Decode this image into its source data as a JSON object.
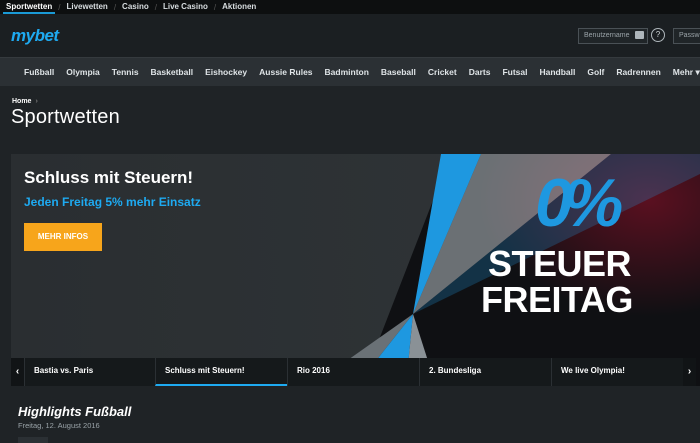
{
  "topbar": {
    "tabs": [
      "Sportwetten",
      "Livewetten",
      "Casino",
      "Live Casino",
      "Aktionen"
    ]
  },
  "header": {
    "logo": "mybet",
    "username_placeholder": "Benutzername",
    "password_placeholder": "Passwort",
    "help_label": "?"
  },
  "nav": {
    "items": [
      "Fußball",
      "Olympia",
      "Tennis",
      "Basketball",
      "Eishockey",
      "Aussie Rules",
      "Badminton",
      "Baseball",
      "Cricket",
      "Darts",
      "Futsal",
      "Handball",
      "Golf",
      "Radrennen",
      "Mehr ▾"
    ]
  },
  "breadcrumb": {
    "home": "Home",
    "separator": "›"
  },
  "page": {
    "title": "Sportwetten"
  },
  "banner": {
    "headline": "Schluss mit Steuern!",
    "subline": "Jeden Freitag 5% mehr Einsatz",
    "button": "MEHR INFOS",
    "percent_graphic": "0%",
    "title_line1": "STEUER",
    "title_line2": "FREITAG"
  },
  "slider": {
    "prev": "‹",
    "next": "›",
    "tabs": [
      "Bastia vs. Paris",
      "Schluss mit Steuern!",
      "Rio 2016",
      "2. Bundesliga",
      "We live Olympia!"
    ],
    "active_index": 1
  },
  "highlights": {
    "title": "Highlights Fußball",
    "date": "Freitag, 12. August 2016"
  },
  "colors": {
    "accent_blue": "#1eaaf1",
    "button_orange": "#f7a51b",
    "background": "#1f2326"
  }
}
